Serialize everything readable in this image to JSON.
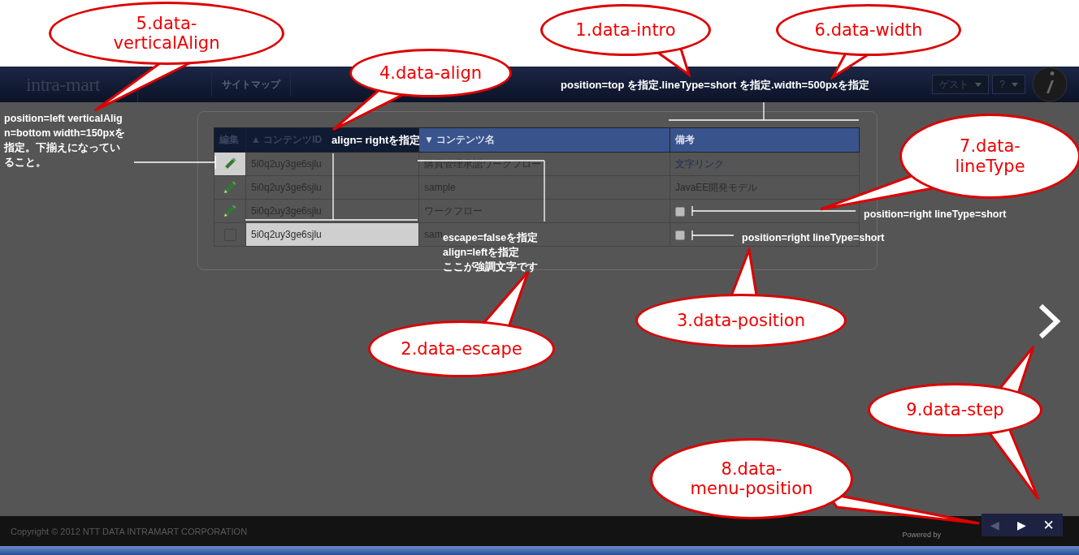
{
  "callouts": [
    {
      "lines": [
        "5.data-",
        "verticalAlign"
      ]
    },
    {
      "lines": [
        "1.data-intro"
      ]
    },
    {
      "lines": [
        "6.data-width"
      ]
    },
    {
      "lines": [
        "4.data-align"
      ]
    },
    {
      "lines": [
        "7.data-",
        "lineType"
      ]
    },
    {
      "lines": [
        "3.data-position"
      ]
    },
    {
      "lines": [
        "2.data-escape"
      ]
    },
    {
      "lines": [
        "9.data-step"
      ]
    },
    {
      "lines": [
        "8.data-",
        "menu-position"
      ]
    }
  ],
  "header": {
    "logo": "intra-mart",
    "nav": [
      {
        "label": "サイトマップ"
      }
    ],
    "user_menu": "ゲスト",
    "help_menu": "?"
  },
  "tooltips": {
    "intro": "position=top を指定.lineType=short を指定.width=500pxを指定",
    "align": "align= rightを指定",
    "left": "position=left verticalAlign=bottom width=150pxを指定。下揃えになっていること。",
    "escape": [
      "escape=falseを指定",
      "align=leftを指定",
      "ここが強調文字です"
    ],
    "linetype": "position=right lineType=short",
    "position": "position=right lineType=short"
  },
  "table": {
    "columns": [
      {
        "label": "編集",
        "dimmed": true
      },
      {
        "label": "▲ コンテンツID",
        "dimmed": true
      },
      {
        "label": "▼ コンテンツ名",
        "dimmed": false
      },
      {
        "label": "備考",
        "dimmed": false
      }
    ],
    "rows": [
      {
        "edit": {
          "kind": "pencil",
          "highlighted": true
        },
        "id": {
          "text": "5i0q2uy3ge6sjlu",
          "highlighted": false
        },
        "name": "購買管理承認ワークフロー",
        "note": {
          "kind": "link",
          "text": "文字リンク"
        }
      },
      {
        "edit": {
          "kind": "pencil",
          "highlighted": false
        },
        "id": {
          "text": "5i0q2uy3ge6sjlu",
          "highlighted": false
        },
        "name": "sample",
        "note": {
          "kind": "text",
          "text": "JavaEE開発モデル"
        }
      },
      {
        "edit": {
          "kind": "pencil",
          "highlighted": false
        },
        "id": {
          "text": "5i0q2uy3ge6sjlu",
          "highlighted": false
        },
        "name": "ワークフロー",
        "note": {
          "kind": "checkbox",
          "checked": false
        }
      },
      {
        "edit": {
          "kind": "checkbox",
          "checked": false,
          "highlighted": false
        },
        "id": {
          "text": "5i0q2uy3ge6sjlu",
          "highlighted": true
        },
        "name": "sam",
        "note": {
          "kind": "checkbox",
          "checked": false
        }
      }
    ]
  },
  "footer": {
    "copyright": "Copyright © 2012 NTT DATA INTRAMART CORPORATION",
    "powered_by": "Powered by"
  },
  "tour_controls": {
    "prev": {
      "label": "◀",
      "disabled": true
    },
    "next": {
      "label": "▶",
      "disabled": false
    },
    "close": "✕"
  }
}
